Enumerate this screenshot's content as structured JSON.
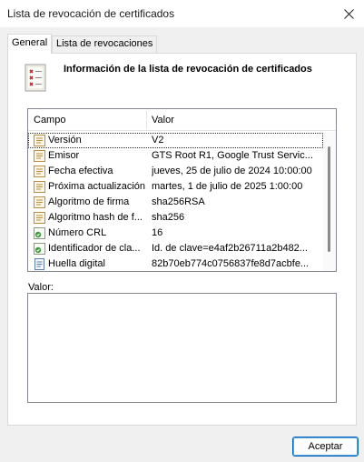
{
  "window": {
    "title": "Lista de revocación de certificados"
  },
  "tabs": [
    {
      "label": "General",
      "active": true
    },
    {
      "label": "Lista de revocaciones",
      "active": false
    }
  ],
  "header": {
    "title": "Información de la lista de revocación de certificados",
    "icon": "certificate-list-icon"
  },
  "list": {
    "columns": [
      "Campo",
      "Valor"
    ],
    "rows": [
      {
        "field": "Versión",
        "value": "V2",
        "icon": "field-icon"
      },
      {
        "field": "Emisor",
        "value": "GTS Root R1, Google Trust Servic...",
        "icon": "field-icon"
      },
      {
        "field": "Fecha efectiva",
        "value": "jueves, 25 de julio de 2024 10:00:00",
        "icon": "field-icon"
      },
      {
        "field": "Próxima actualización",
        "value": "martes, 1 de julio de 2025 1:00:00",
        "icon": "field-icon"
      },
      {
        "field": "Algoritmo de firma",
        "value": "sha256RSA",
        "icon": "field-icon"
      },
      {
        "field": "Algoritmo hash de f...",
        "value": "sha256",
        "icon": "field-icon"
      },
      {
        "field": "Número CRL",
        "value": "16",
        "icon": "extension-icon"
      },
      {
        "field": "Identificador de cla...",
        "value": "Id. de clave=e4af2b26711a2b482...",
        "icon": "extension-icon"
      },
      {
        "field": "Huella digital",
        "value": "82b70eb774c0756837fe8d7acbfe...",
        "icon": "document-icon"
      }
    ]
  },
  "details": {
    "label": "Valor:",
    "value": ""
  },
  "buttons": {
    "ok": "Aceptar"
  },
  "colors": {
    "accent": "#0067c0"
  }
}
